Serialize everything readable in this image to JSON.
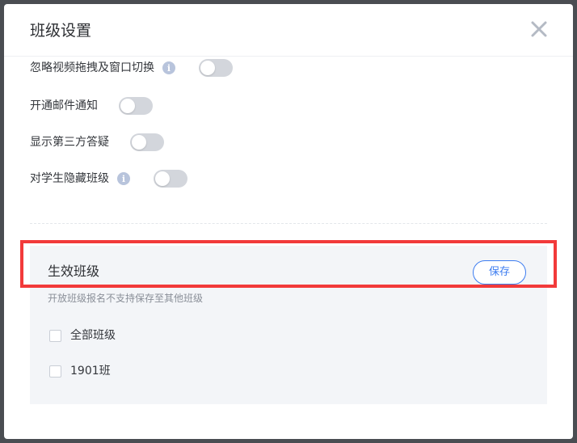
{
  "dialog": {
    "title": "班级设置",
    "close_icon": "close-icon"
  },
  "settings": [
    {
      "label": "忽略视频拖拽及窗口切换",
      "has_info": true,
      "enabled": false
    },
    {
      "label": "开通邮件通知",
      "has_info": false,
      "enabled": false
    },
    {
      "label": "显示第三方答疑",
      "has_info": false,
      "enabled": false
    },
    {
      "label": "对学生隐藏班级",
      "has_info": true,
      "enabled": false
    }
  ],
  "effective_classes": {
    "title": "生效班级",
    "save_label": "保存",
    "hint": "开放班级报名不支持保存至其他班级",
    "options": [
      {
        "label": "全部班级",
        "checked": false
      },
      {
        "label": "1901班",
        "checked": false
      }
    ]
  },
  "info_icon_glyph": "i",
  "colors": {
    "accent": "#3c7cf0",
    "highlight": "#f23a3a",
    "toggle_off": "#d3d6dc",
    "info_icon": "#b8c4dc",
    "panel_bg": "#f3f5f8"
  }
}
